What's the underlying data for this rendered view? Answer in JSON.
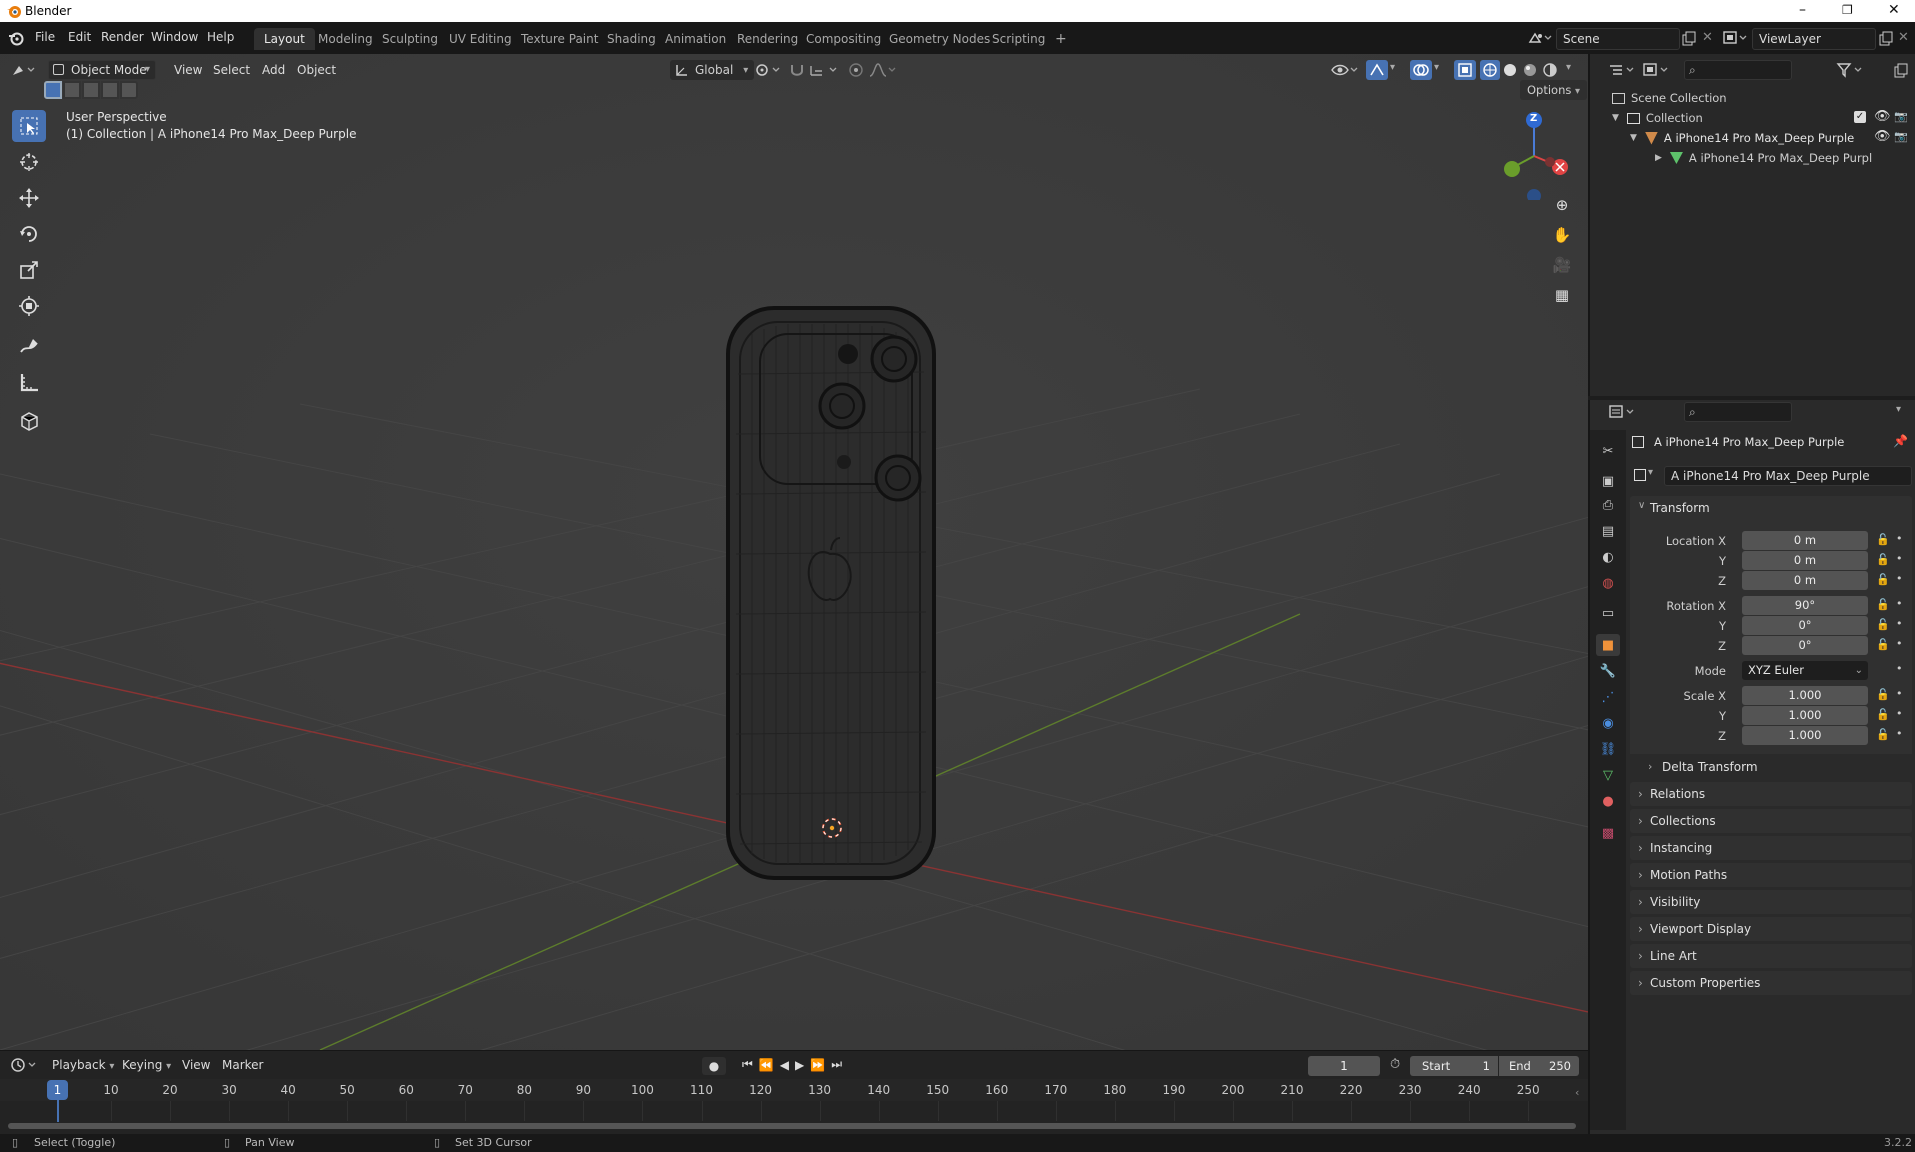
{
  "window": {
    "title": "Blender",
    "minimize": "–",
    "maximize": "❐",
    "close": "✕"
  },
  "menus": [
    "File",
    "Edit",
    "Render",
    "Window",
    "Help"
  ],
  "workspaces": [
    "Layout",
    "Modeling",
    "Sculpting",
    "UV Editing",
    "Texture Paint",
    "Shading",
    "Animation",
    "Rendering",
    "Compositing",
    "Geometry Nodes",
    "Scripting",
    "+"
  ],
  "active_workspace": "Layout",
  "scene": "Scene",
  "view_layer": "ViewLayer",
  "viewport": {
    "mode": "Object Mode",
    "menus": [
      "View",
      "Select",
      "Add",
      "Object"
    ],
    "orientation": "Global",
    "options": "Options",
    "info_line1": "User Perspective",
    "info_line2": "(1) Collection | A iPhone14 Pro Max_Deep Purple",
    "gizmo_z": "Z"
  },
  "outliner": {
    "scene_collection": "Scene Collection",
    "collection": "Collection",
    "object": "A iPhone14 Pro Max_Deep Purple",
    "mesh": "A iPhone14 Pro Max_Deep Purpl"
  },
  "properties": {
    "header_object": "A iPhone14 Pro Max_Deep Purple",
    "object_name": "A iPhone14 Pro Max_Deep Purple",
    "transform_label": "Transform",
    "location": {
      "label": "Location X",
      "x": "0 m",
      "y": "0 m",
      "z": "0 m"
    },
    "rotation": {
      "label": "Rotation X",
      "x": "90°",
      "y": "0°",
      "z": "0°"
    },
    "mode_label": "Mode",
    "mode_value": "XYZ Euler",
    "scale": {
      "label": "Scale X",
      "x": "1.000",
      "y": "1.000",
      "z": "1.000"
    },
    "axis_y": "Y",
    "axis_z": "Z",
    "delta": "Delta Transform",
    "panels": [
      "Relations",
      "Collections",
      "Instancing",
      "Motion Paths",
      "Visibility",
      "Viewport Display",
      "Line Art",
      "Custom Properties"
    ]
  },
  "timeline": {
    "menus": [
      "Playback",
      "Keying",
      "View",
      "Marker"
    ],
    "current_frame": "1",
    "start_label": "Start",
    "start": "1",
    "end_label": "End",
    "end": "250",
    "ticks": [
      "1",
      "10",
      "20",
      "30",
      "40",
      "50",
      "60",
      "70",
      "80",
      "90",
      "100",
      "110",
      "120",
      "130",
      "140",
      "150",
      "160",
      "170",
      "180",
      "190",
      "200",
      "210",
      "220",
      "230",
      "240",
      "250"
    ]
  },
  "status": {
    "left": "Select (Toggle)",
    "middle": "Pan View",
    "right": "Set 3D Cursor",
    "version": "3.2.2"
  }
}
